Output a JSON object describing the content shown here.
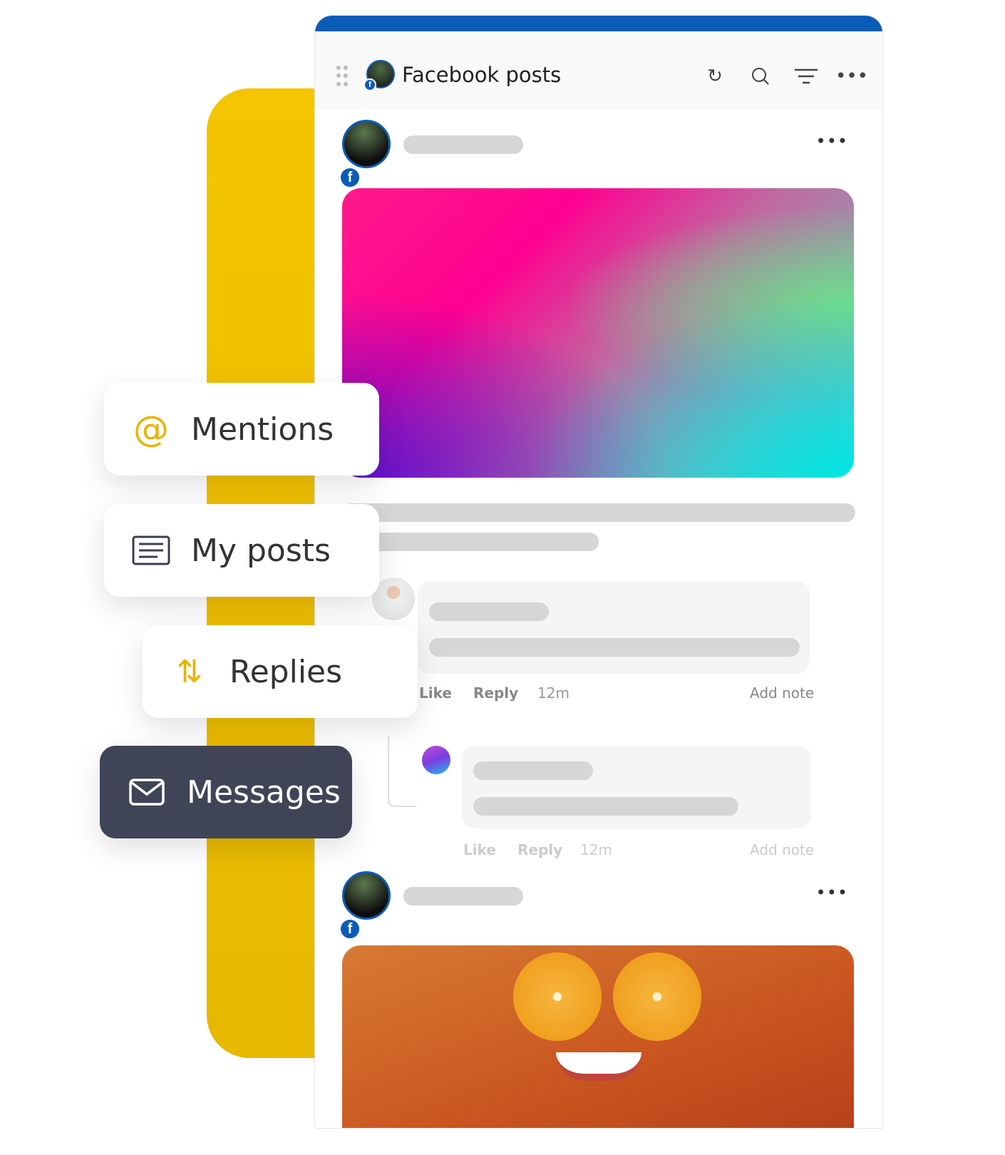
{
  "panel": {
    "title": "Facebook posts",
    "accent": "#0a5cb8",
    "icons": [
      "drag-handle-icon",
      "refresh-icon",
      "search-icon",
      "filter-icon",
      "more-icon"
    ]
  },
  "comments": [
    {
      "like": "Like",
      "reply": "Reply",
      "time": "12m",
      "note": "Add note"
    },
    {
      "like": "Like",
      "reply": "Reply",
      "time": "12m",
      "note": "Add note"
    }
  ],
  "menu": [
    {
      "label": "Mentions",
      "icon": "at-icon"
    },
    {
      "label": "My posts",
      "icon": "posts-icon"
    },
    {
      "label": "Replies",
      "icon": "retweet-icon"
    },
    {
      "label": "Messages",
      "icon": "envelope-icon"
    }
  ],
  "brand_yellow": "#f4c500"
}
